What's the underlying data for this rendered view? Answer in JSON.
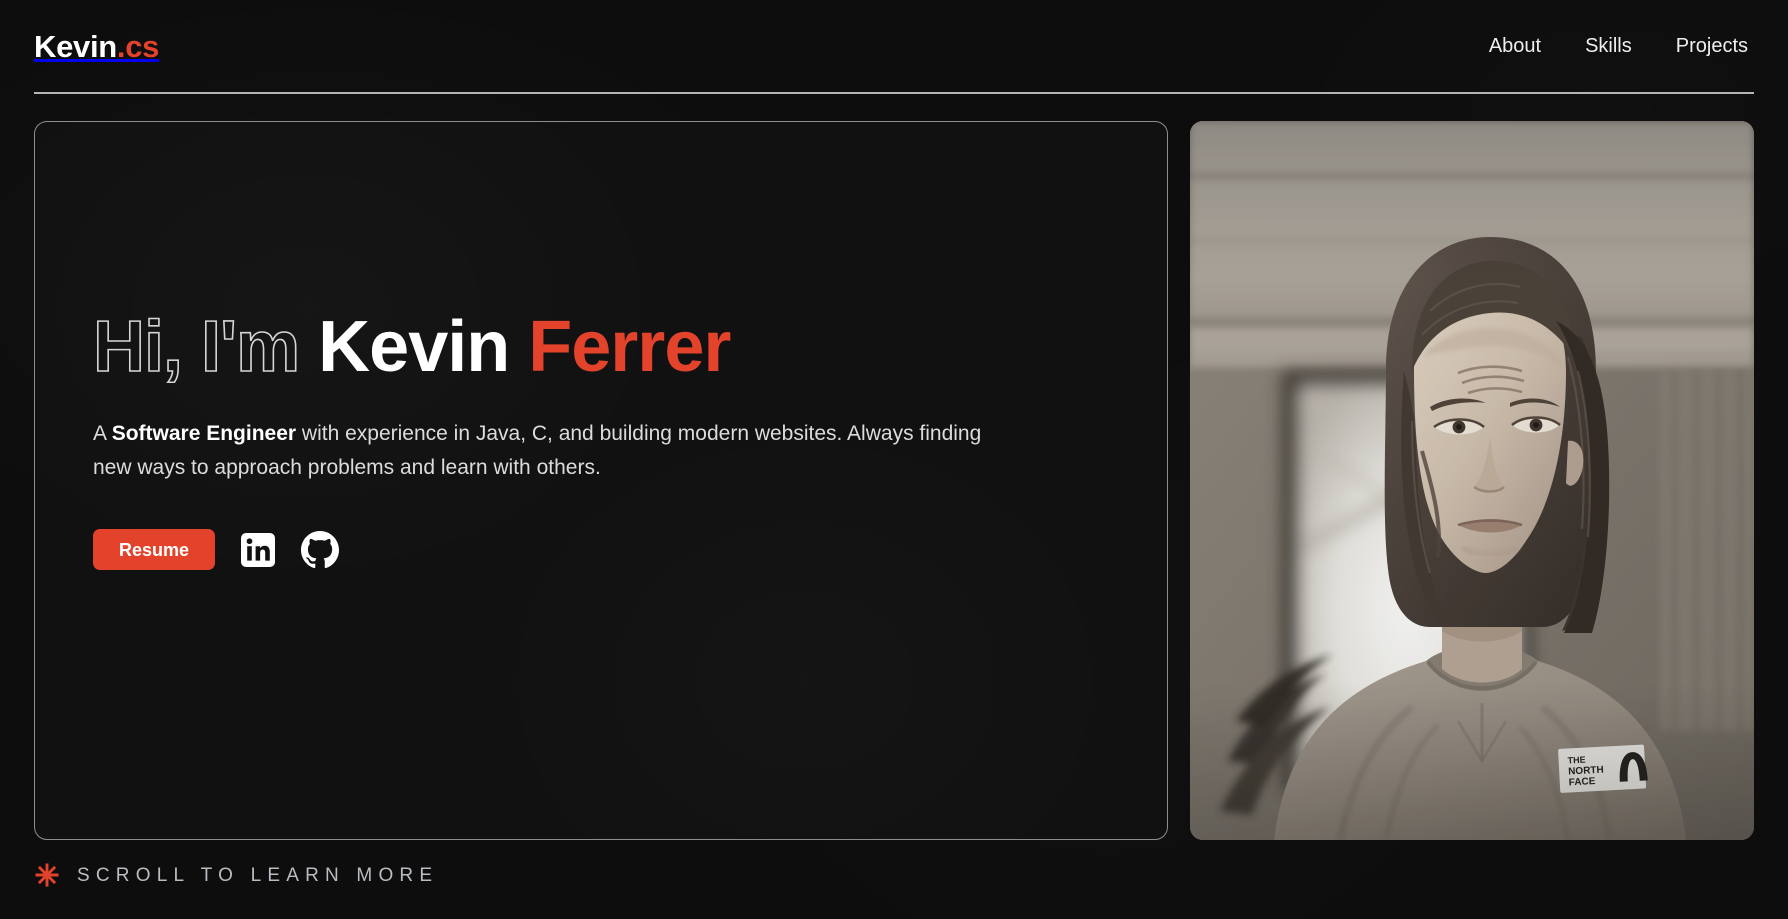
{
  "header": {
    "brand": {
      "name": "Kevin",
      "extension": ".cs"
    },
    "nav": [
      {
        "label": "About",
        "name": "nav-link-about"
      },
      {
        "label": "Skills",
        "name": "nav-link-skills"
      },
      {
        "label": "Projects",
        "name": "nav-link-projects"
      }
    ]
  },
  "hero": {
    "headline": {
      "outline_part": "Hi, I'm",
      "first_name": "Kevin",
      "last_name": "Ferrer"
    },
    "intro": {
      "lead": "A ",
      "role": "Software Engineer",
      "body": " with experience in Java, C, and building modern websites. Always finding new ways to approach problems and learn with others."
    },
    "actions": {
      "resume_label": "Resume",
      "linkedin_icon": "linkedin-icon",
      "github_icon": "github-icon"
    },
    "portrait": {
      "alt": "Portrait of Kevin Ferrer in a crewneck sweatshirt",
      "patch_line1": "THE",
      "patch_line2": "NORTH",
      "patch_line3": "FACE"
    }
  },
  "scroll_cue": {
    "icon": "asterisk-star-icon",
    "label": "SCROLL TO LEARN MORE"
  },
  "colors": {
    "background": "#0d0d0d",
    "card_background": "#111111",
    "card_border": "#8e8e8e",
    "accent": "#e2432a",
    "text_primary": "#ffffff",
    "text_secondary": "#dcdcdc",
    "text_muted": "#b9bcc2",
    "divider": "#b4b4b4"
  }
}
